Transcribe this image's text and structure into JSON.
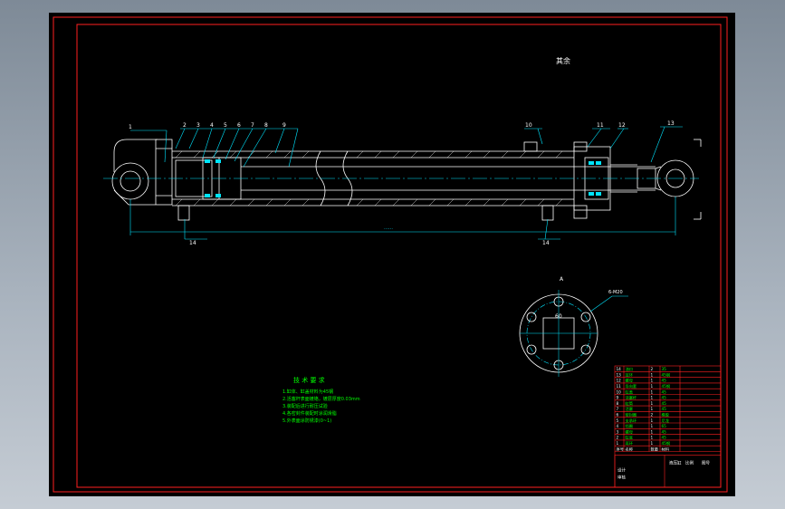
{
  "drawing": {
    "view_label": "其余",
    "section_label": "A",
    "detail_label": "A",
    "dimension_text": "……",
    "detail_dim": "60",
    "detail_callout": "6-M20",
    "part_callouts": [
      "1",
      "2",
      "3",
      "4",
      "5",
      "6",
      "7",
      "8",
      "9",
      "10",
      "11",
      "12",
      "13",
      "14",
      "14"
    ]
  },
  "tech_req": {
    "title": "技 术 要 求",
    "lines": [
      "1.缸体、缸盖材料为45钢",
      "2.活塞杆表面镀铬，镀层厚度0.03mm",
      "3.装配后进行耐压试验",
      "4.各密封件装配时涂润滑脂",
      "5.外表面涂防锈漆(0~1)"
    ]
  },
  "bom": {
    "rows": [
      [
        "14",
        "油口",
        "2",
        "35"
      ],
      [
        "13",
        "耳环",
        "1",
        "45钢"
      ],
      [
        "12",
        "螺母",
        "1",
        "45"
      ],
      [
        "11",
        "导向套",
        "1",
        "45钢"
      ],
      [
        "10",
        "缸盖",
        "1",
        "45"
      ],
      [
        "9",
        "活塞杆",
        "1",
        "45"
      ],
      [
        "8",
        "缸筒",
        "1",
        "45"
      ],
      [
        "7",
        "活塞",
        "1",
        "45"
      ],
      [
        "6",
        "密封圈",
        "2",
        "橡胶"
      ],
      [
        "5",
        "支承环",
        "1",
        "尼龙"
      ],
      [
        "4",
        "挡圈",
        "1",
        "65"
      ],
      [
        "3",
        "螺母",
        "1",
        "45"
      ],
      [
        "2",
        "缸底",
        "1",
        "45"
      ],
      [
        "1",
        "耳环",
        "1",
        "45钢"
      ]
    ],
    "header": [
      "序号",
      "名称",
      "数量",
      "材料"
    ],
    "title_cells": [
      "液压缸",
      "比例",
      "图号",
      "设计",
      "审核"
    ]
  },
  "colors": {
    "frame": "#ff2020",
    "line": "#ffffff",
    "accent": "#00e5ff",
    "text": "#00ff00",
    "hatch": "#ffffff"
  }
}
